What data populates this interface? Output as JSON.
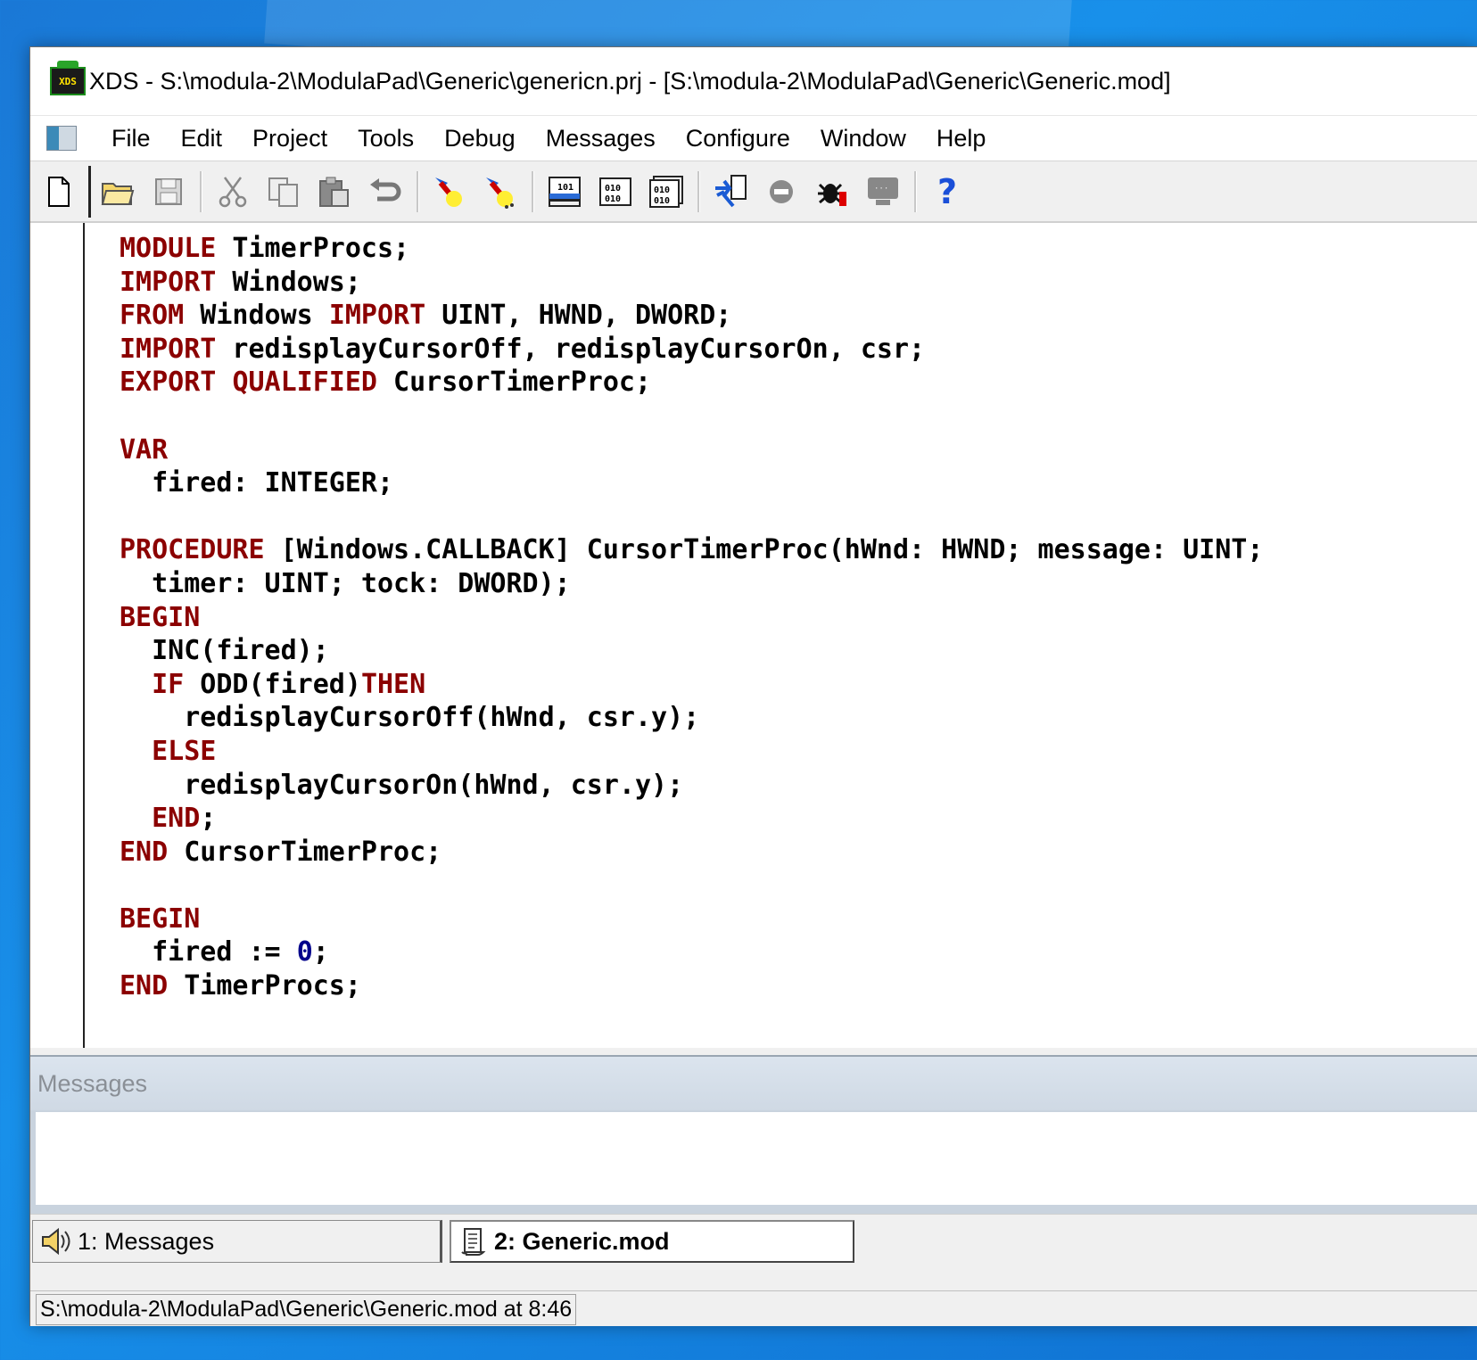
{
  "window": {
    "app_name": "XDS",
    "title_rest": " - S:\\modula-2\\ModulaPad\\Generic\\genericn.prj - [S:\\modula-2\\ModulaPad\\Generic\\Generic.mod]",
    "icon_text": "XDS"
  },
  "menu": {
    "items": [
      "File",
      "Edit",
      "Project",
      "Tools",
      "Debug",
      "Messages",
      "Configure",
      "Window",
      "Help"
    ]
  },
  "toolbar": {
    "icons": [
      "new-file-icon",
      "open-folder-icon",
      "save-icon",
      "cut-icon",
      "copy-icon",
      "paste-icon",
      "undo-icon",
      "compile-icon",
      "make-icon",
      "debug-screen-icon",
      "binary-window-icon",
      "binary-window-2-icon",
      "run-icon",
      "stop-icon",
      "bug-icon",
      "terminal-icon",
      "help-icon"
    ],
    "help_glyph": "?"
  },
  "editor": {
    "lines": [
      [
        {
          "t": "MODULE",
          "kw": true
        },
        {
          "t": " TimerProcs;"
        }
      ],
      [
        {
          "t": "IMPORT",
          "kw": true
        },
        {
          "t": " Windows;"
        }
      ],
      [
        {
          "t": "FROM",
          "kw": true
        },
        {
          "t": " Windows "
        },
        {
          "t": "IMPORT",
          "kw": true
        },
        {
          "t": " UINT, HWND, DWORD;"
        }
      ],
      [
        {
          "t": "IMPORT",
          "kw": true
        },
        {
          "t": " redisplayCursorOff, redisplayCursorOn, csr;"
        }
      ],
      [
        {
          "t": "EXPORT",
          "kw": true
        },
        {
          "t": " "
        },
        {
          "t": "QUALIFIED",
          "kw": true
        },
        {
          "t": " CursorTimerProc;"
        }
      ],
      [],
      [
        {
          "t": "VAR",
          "kw": true
        }
      ],
      [
        {
          "t": "  fired: INTEGER;"
        }
      ],
      [],
      [
        {
          "t": "PROCEDURE",
          "kw": true
        },
        {
          "t": " [Windows.CALLBACK] CursorTimerProc(hWnd: HWND; message: UINT;"
        }
      ],
      [
        {
          "t": "  timer: UINT; tock: DWORD);"
        }
      ],
      [
        {
          "t": "BEGIN",
          "kw": true
        }
      ],
      [
        {
          "t": "  INC(fired);"
        }
      ],
      [
        {
          "t": "  "
        },
        {
          "t": "IF",
          "kw": true
        },
        {
          "t": " ODD(fired)"
        },
        {
          "t": "THEN",
          "kw": true
        }
      ],
      [
        {
          "t": "    redisplayCursorOff(hWnd, csr.y);"
        }
      ],
      [
        {
          "t": "  "
        },
        {
          "t": "ELSE",
          "kw": true
        }
      ],
      [
        {
          "t": "    redisplayCursorOn(hWnd, csr.y);"
        }
      ],
      [
        {
          "t": "  "
        },
        {
          "t": "END",
          "kw": true
        },
        {
          "t": ";"
        }
      ],
      [
        {
          "t": "END",
          "kw": true
        },
        {
          "t": " CursorTimerProc;"
        }
      ],
      [],
      [
        {
          "t": "BEGIN",
          "kw": true
        }
      ],
      [
        {
          "t": "  fired := "
        },
        {
          "t": "0",
          "num": true
        },
        {
          "t": ";"
        }
      ],
      [
        {
          "t": "END",
          "kw": true
        },
        {
          "t": " TimerProcs;"
        }
      ]
    ]
  },
  "messages_panel": {
    "title": "Messages"
  },
  "tabs": [
    {
      "label": "1: Messages",
      "icon": "speaker-icon",
      "active": false
    },
    {
      "label": "2: Generic.mod",
      "icon": "scroll-icon",
      "active": true
    }
  ],
  "status": {
    "text": "S:\\modula-2\\ModulaPad\\Generic\\Generic.mod at 8:46"
  },
  "colors": {
    "keyword": "#8b0000",
    "number": "#00008b",
    "desktop": "#1584e0"
  }
}
